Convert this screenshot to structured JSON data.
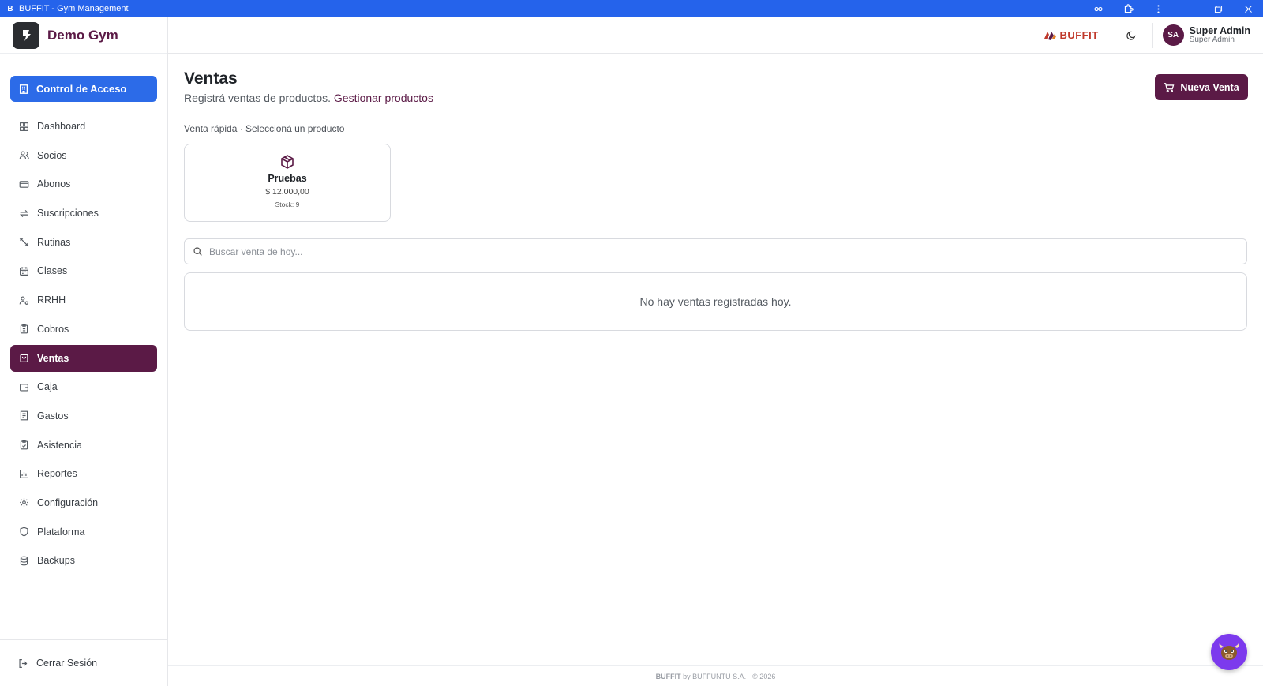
{
  "window": {
    "title": "BUFFIT - Gym Management",
    "app_icon_letter": "B"
  },
  "sidebar": {
    "brand_name": "Demo Gym",
    "access_button": "Control de Acceso",
    "items": [
      {
        "label": "Dashboard",
        "icon": "dashboard-icon"
      },
      {
        "label": "Socios",
        "icon": "users-icon"
      },
      {
        "label": "Abonos",
        "icon": "card-icon"
      },
      {
        "label": "Suscripciones",
        "icon": "repeat-icon"
      },
      {
        "label": "Rutinas",
        "icon": "dumbbell-icon"
      },
      {
        "label": "Clases",
        "icon": "calendar-icon"
      },
      {
        "label": "RRHH",
        "icon": "user-cog-icon"
      },
      {
        "label": "Cobros",
        "icon": "clipboard-icon"
      },
      {
        "label": "Ventas",
        "icon": "shopping-bag-icon",
        "active": true
      },
      {
        "label": "Caja",
        "icon": "wallet-icon"
      },
      {
        "label": "Gastos",
        "icon": "receipt-icon"
      },
      {
        "label": "Asistencia",
        "icon": "clipboard-check-icon"
      },
      {
        "label": "Reportes",
        "icon": "bar-chart-icon"
      },
      {
        "label": "Configuración",
        "icon": "gear-icon"
      },
      {
        "label": "Plataforma",
        "icon": "shield-icon"
      },
      {
        "label": "Backups",
        "icon": "database-icon"
      }
    ],
    "logout": "Cerrar Sesión"
  },
  "header": {
    "logo_text": "BUFFIT",
    "user": {
      "initials": "SA",
      "name": "Super Admin",
      "role": "Super Admin"
    }
  },
  "main": {
    "title": "Ventas",
    "subtitle": "Registrá ventas de productos.",
    "subtitle_link": "Gestionar productos",
    "new_sale_button": "Nueva Venta",
    "quick_sale_label": "Venta rápida · Seleccioná un producto",
    "product": {
      "name": "Pruebas",
      "price": "$ 12.000,00",
      "stock": "Stock: 9"
    },
    "search_placeholder": "Buscar venta de hoy...",
    "empty_message": "No hay ventas registradas hoy."
  },
  "footer": {
    "brand": "BUFFIT",
    "text": "by BUFFUNTU S.A. · © 2026"
  },
  "colors": {
    "primary": "#5b1a46",
    "accent_blue": "#2c6be8",
    "titlebar": "#2563eb"
  }
}
